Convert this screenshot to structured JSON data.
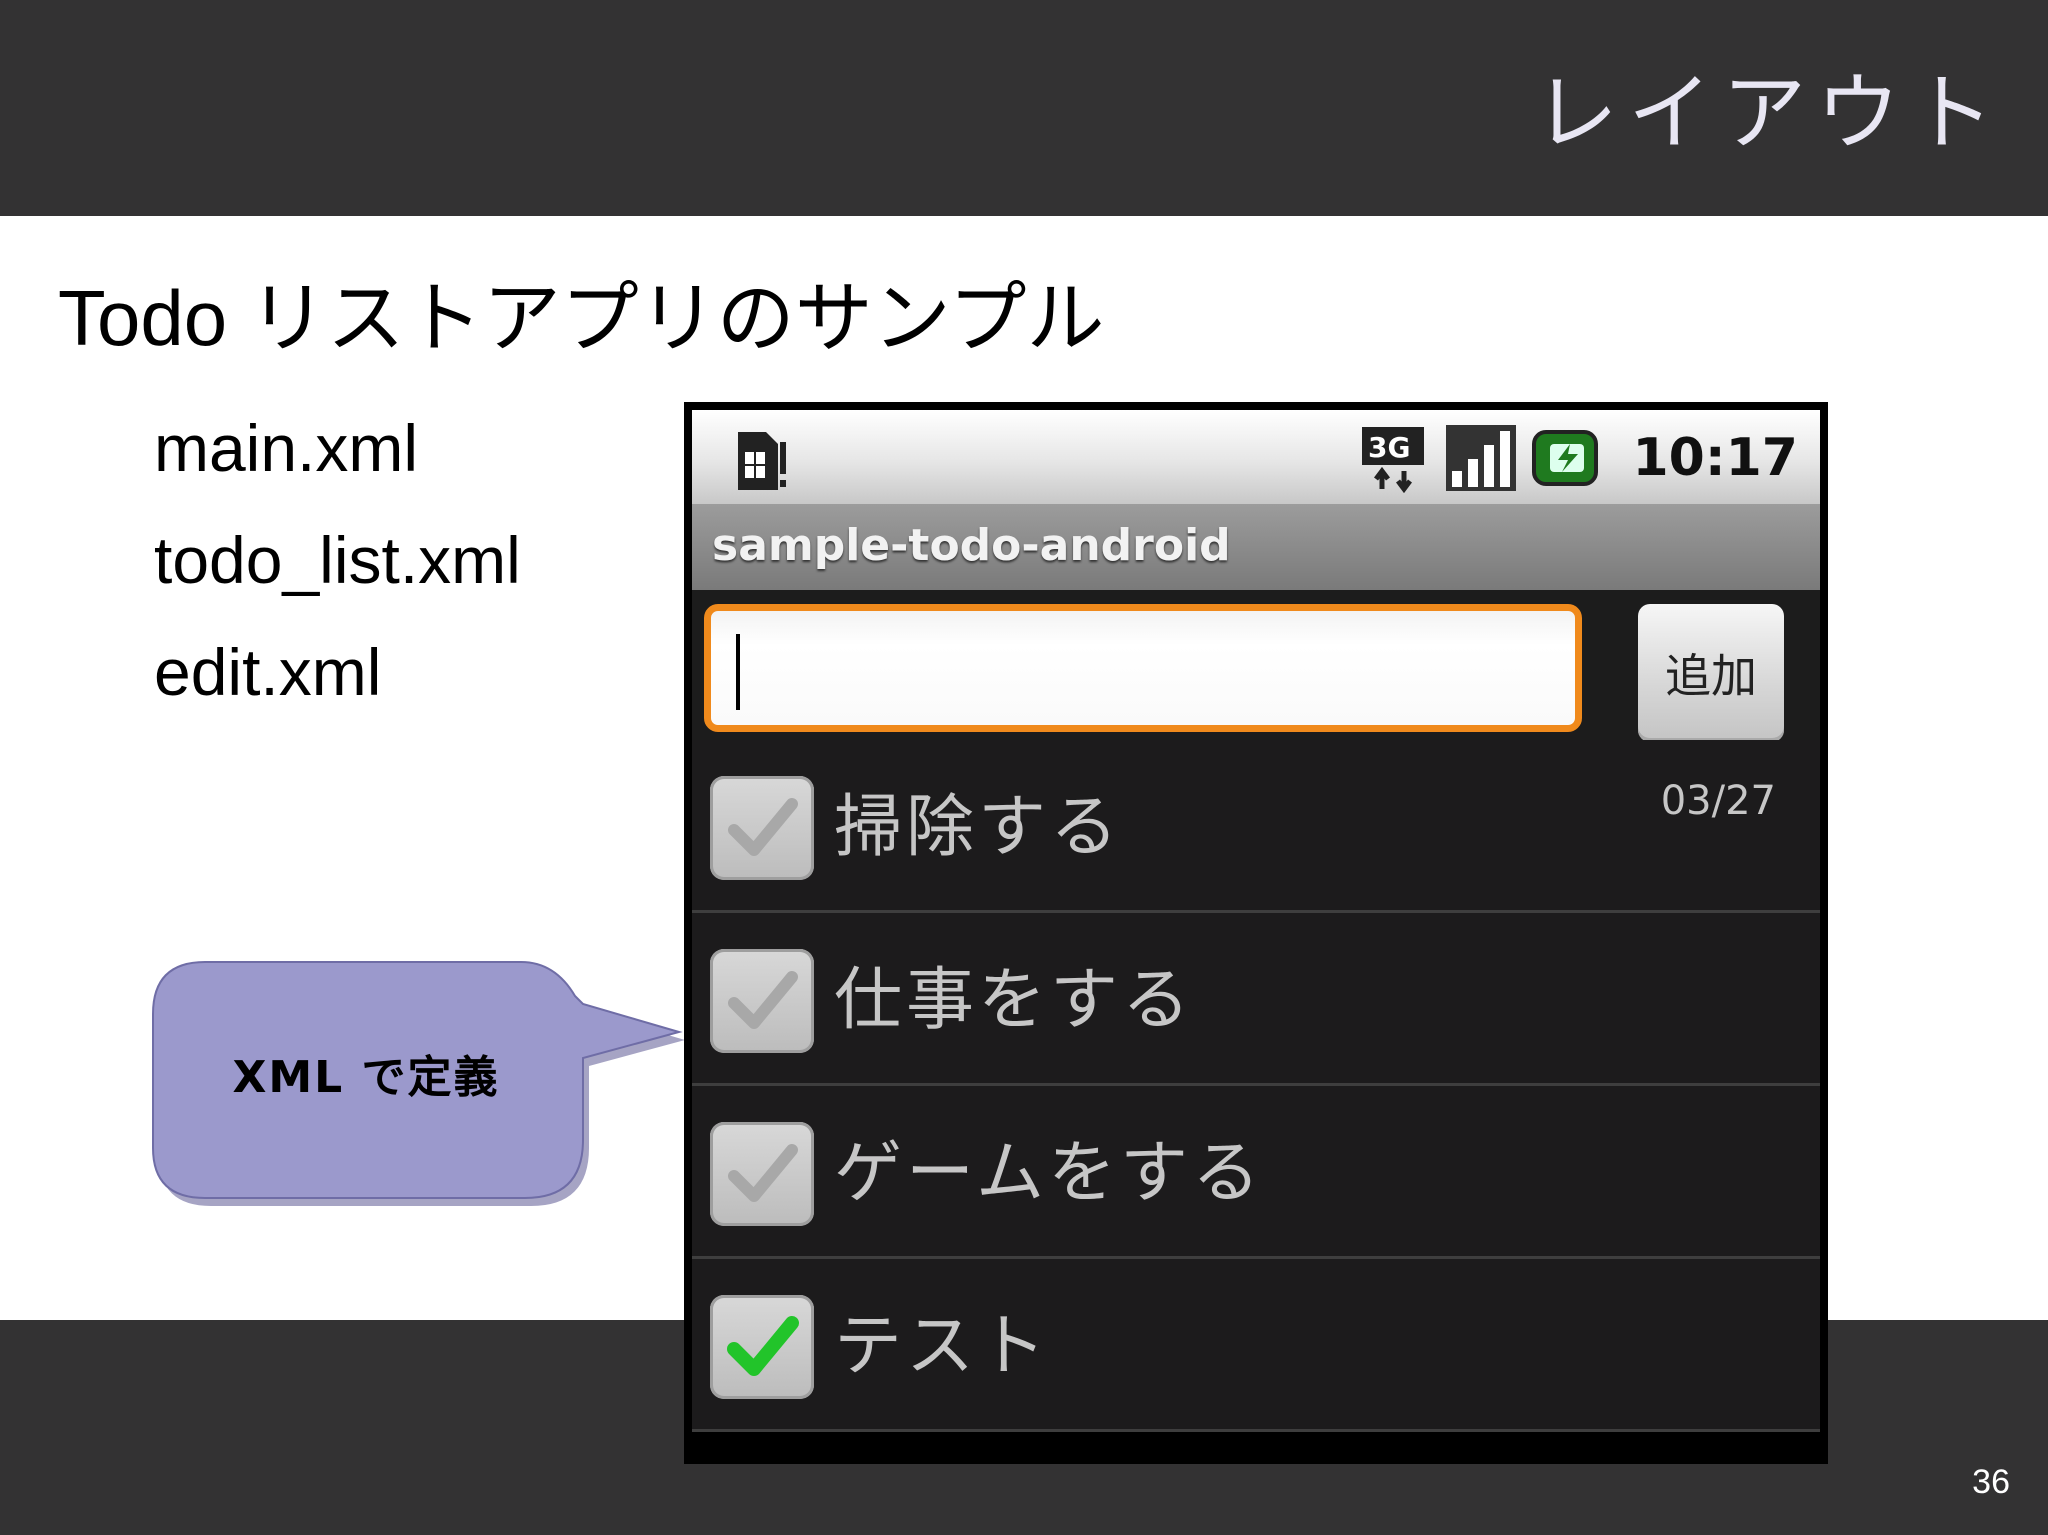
{
  "slide": {
    "title": "レイアウト",
    "heading": "Todo リストアプリのサンプル",
    "files": [
      "main.xml",
      "todo_list.xml",
      "edit.xml"
    ],
    "callout": "XML で定義",
    "page_number": "36"
  },
  "phone": {
    "status_bar": {
      "network": "3G",
      "time": "10:17"
    },
    "app_title": "sample-todo-android",
    "input": {
      "value": "",
      "placeholder": ""
    },
    "add_button": "追加",
    "todos": [
      {
        "text": "掃除する",
        "date": "03/27",
        "checked": false
      },
      {
        "text": "仕事をする",
        "date": "",
        "checked": false
      },
      {
        "text": "ゲームをする",
        "date": "",
        "checked": false
      },
      {
        "text": "テスト",
        "date": "",
        "checked": true
      }
    ],
    "colors": {
      "input_border": "#f08a1c",
      "check_active": "#22c42a",
      "check_inactive": "#a8a8a8"
    }
  }
}
